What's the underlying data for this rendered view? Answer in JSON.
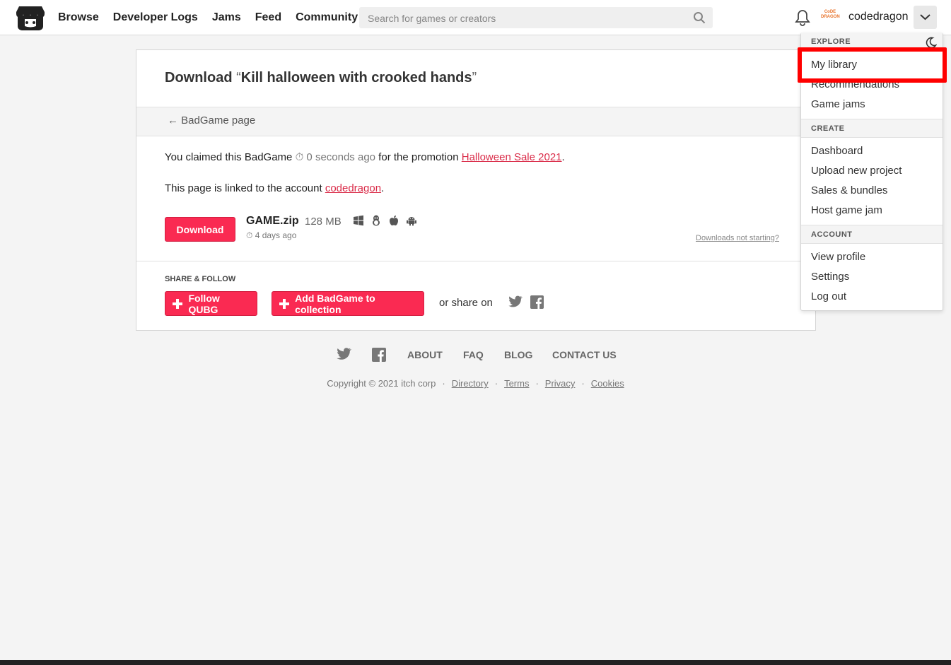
{
  "header": {
    "nav": [
      "Browse",
      "Developer Logs",
      "Jams",
      "Feed",
      "Community"
    ],
    "search_placeholder": "Search for games or creators",
    "username": "codedragon",
    "avatar_text_line1": "CoDE",
    "avatar_text_line2": "DRAGON"
  },
  "page": {
    "title_prefix": "Download ",
    "quote_open": "“",
    "game_title": "Kill halloween with crooked hands",
    "quote_close": "”",
    "back_link": "← BadGame page",
    "claim_text": "You claimed this BadGame ",
    "claim_time": "⏱ 0 seconds ago",
    "claim_for": " for the promotion ",
    "promotion": "Halloween Sale 2021",
    "period": ".",
    "linked_text": "This page is linked to the account ",
    "linked_account": "codedragon",
    "download_label": "Download",
    "file_name": "GAME.zip",
    "file_size": "128 MB",
    "file_date": "⏱ 4 days ago",
    "platform_icons": [
      "windows-icon",
      "linux-icon",
      "apple-icon",
      "android-icon"
    ],
    "downloads_not_starting": "Downloads not starting?",
    "share_title": "SHARE & FOLLOW",
    "follow_label": "Follow QUBG",
    "collection_label": "Add BadGame to collection",
    "or_share": "or share on"
  },
  "footer": {
    "links": [
      "ABOUT",
      "FAQ",
      "BLOG",
      "CONTACT US"
    ],
    "copyright": "Copyright © 2021 itch corp",
    "legal": [
      "Directory",
      "Terms",
      "Privacy",
      "Cookies"
    ],
    "sep": "·"
  },
  "dropdown": {
    "explore_head": "EXPLORE",
    "explore_items": [
      "My library",
      "Recommendations",
      "Game jams"
    ],
    "create_head": "CREATE",
    "create_items": [
      "Dashboard",
      "Upload new project",
      "Sales & bundles",
      "Host game jam"
    ],
    "account_head": "ACCOUNT",
    "account_items": [
      "View profile",
      "Settings",
      "Log out"
    ]
  },
  "colors": {
    "accent": "#fa2a52",
    "link_red": "#da2c49",
    "highlight": "#ff0000"
  }
}
